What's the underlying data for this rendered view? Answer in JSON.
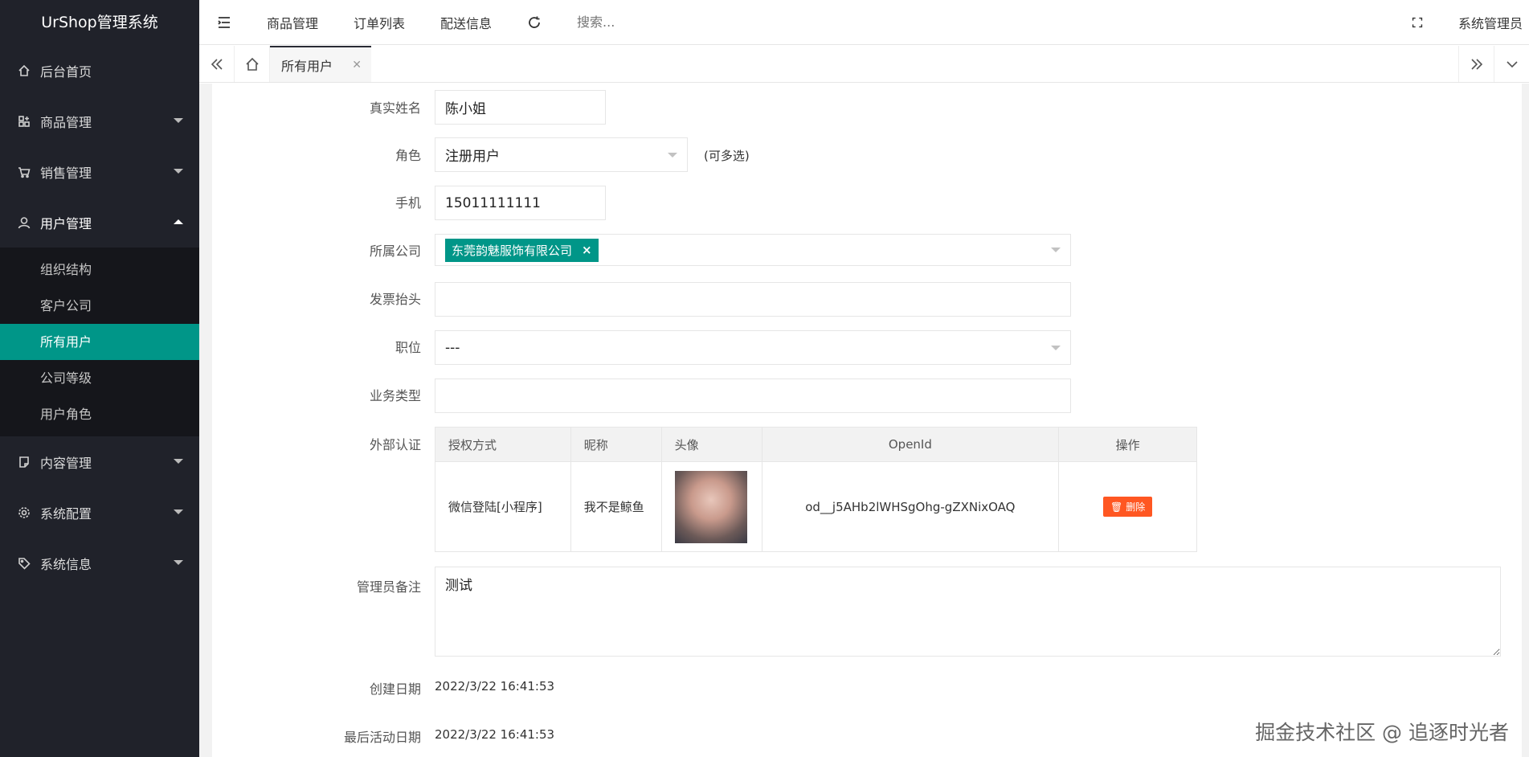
{
  "app": {
    "title": "UrShop管理系统"
  },
  "sidebar": {
    "items": [
      {
        "label": "后台首页",
        "icon": "home-icon"
      },
      {
        "label": "商品管理",
        "icon": "apps-icon"
      },
      {
        "label": "销售管理",
        "icon": "cart-icon"
      },
      {
        "label": "用户管理",
        "icon": "user-icon"
      },
      {
        "label": "内容管理",
        "icon": "note-icon"
      },
      {
        "label": "系统配置",
        "icon": "gear-icon"
      },
      {
        "label": "系统信息",
        "icon": "tag-icon"
      }
    ],
    "user_sub": [
      "组织结构",
      "客户公司",
      "所有用户",
      "公司等级",
      "用户角色"
    ]
  },
  "topbar": {
    "menu": [
      "商品管理",
      "订单列表",
      "配送信息"
    ],
    "search_placeholder": "搜索...",
    "user": "系统管理员"
  },
  "tabs": {
    "active": "所有用户"
  },
  "form": {
    "real_name": {
      "label": "真实姓名",
      "value": "陈小姐"
    },
    "role": {
      "label": "角色",
      "value": "注册用户",
      "hint": "(可多选)"
    },
    "phone": {
      "label": "手机",
      "value": "15011111111"
    },
    "company": {
      "label": "所属公司",
      "tag": "东莞韵魅服饰有限公司"
    },
    "invoice": {
      "label": "发票抬头",
      "value": ""
    },
    "position": {
      "label": "职位",
      "value": "---"
    },
    "business": {
      "label": "业务类型",
      "value": ""
    },
    "auth": {
      "label": "外部认证",
      "headers": [
        "授权方式",
        "昵称",
        "头像",
        "OpenId",
        "操作"
      ],
      "rows": [
        {
          "method": "微信登陆[小程序]",
          "nickname": "我不是鲸鱼",
          "openid": "od__j5AHb2lWHSgOhg-gZXNixOAQ",
          "action": "删除"
        }
      ]
    },
    "note": {
      "label": "管理员备注",
      "value": "测试"
    },
    "created": {
      "label": "创建日期",
      "value": "2022/3/22 16:41:53"
    },
    "last_active": {
      "label": "最后活动日期",
      "value": "2022/3/22 16:41:53"
    }
  },
  "watermark": "掘金技术社区 @ 追逐时光者"
}
